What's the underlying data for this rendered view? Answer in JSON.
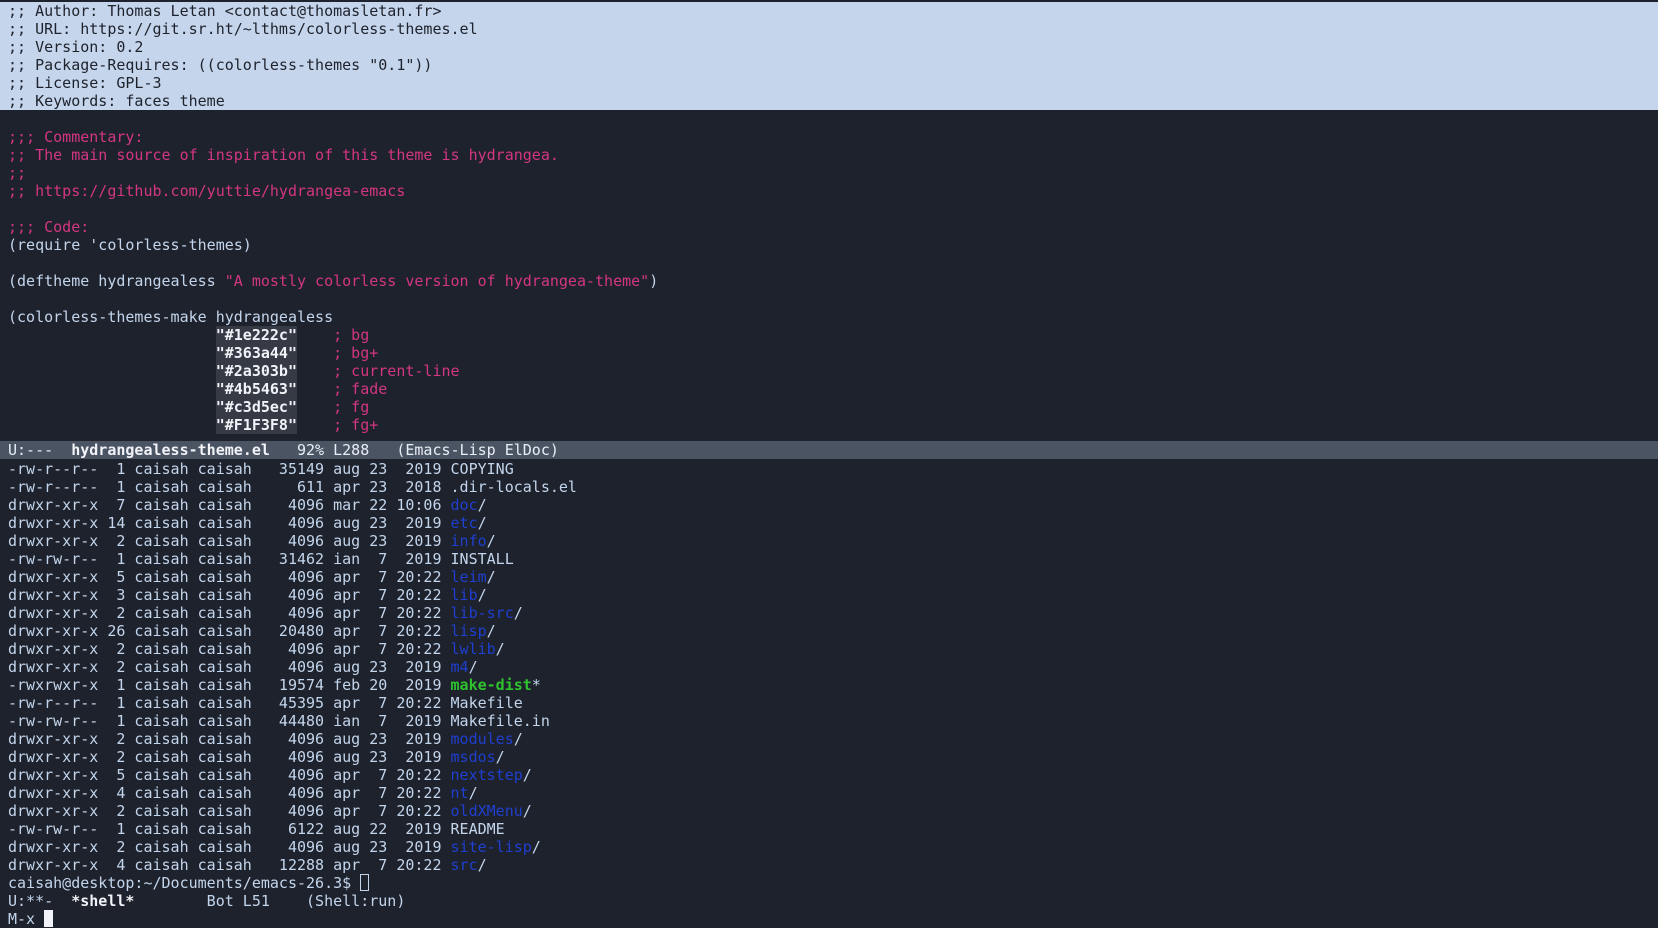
{
  "editor": {
    "header_lines": [
      ";; Author: Thomas Letan <contact@thomasletan.fr>",
      ";; URL: https://git.sr.ht/~lthms/colorless-themes.el",
      ";; Version: 0.2",
      ";; Package-Requires: ((colorless-themes \"0.1\"))",
      ";; License: GPL-3",
      ";; Keywords: faces theme"
    ],
    "commentary_lines": [
      ";;; Commentary:",
      ";; The main source of inspiration of this theme is hydrangea.",
      ";;",
      ";; https://github.com/yuttie/hydrangea-emacs"
    ],
    "code_header": ";;; Code:",
    "require_line": "(require 'colorless-themes)",
    "deftheme_prefix": "(deftheme hydrangealess ",
    "deftheme_string": "\"A mostly colorless version of hydrangea-theme\"",
    "deftheme_suffix": ")",
    "make_line": "(colorless-themes-make hydrangealess",
    "indent": "                       ",
    "colors": [
      {
        "hex": "\"#1e222c\"",
        "gap": "    ",
        "comment": "; bg"
      },
      {
        "hex": "\"#363a44\"",
        "gap": "    ",
        "comment": "; bg+"
      },
      {
        "hex": "\"#2a303b\"",
        "gap": "    ",
        "comment": "; current-line"
      },
      {
        "hex": "\"#4b5463\"",
        "gap": "    ",
        "comment": "; fade"
      },
      {
        "hex": "\"#c3d5ec\"",
        "gap": "    ",
        "comment": "; fg"
      },
      {
        "hex": "\"#F1F3F8\"",
        "gap": "    ",
        "comment": "; fg+"
      }
    ]
  },
  "modeline_top": {
    "status": "U:---  ",
    "buffer": "hydrangealess-theme.el",
    "info": "   92% L288   (Emacs-Lisp ElDoc)"
  },
  "shell": {
    "rows": [
      {
        "perm": "-rw-r--r--  1 caisah caisah   35149 aug 23  2019 ",
        "name": "COPYING",
        "kind": "file",
        "suffix": ""
      },
      {
        "perm": "-rw-r--r--  1 caisah caisah     611 apr 23  2018 ",
        "name": ".dir-locals.el",
        "kind": "file",
        "suffix": ""
      },
      {
        "perm": "drwxr-xr-x  7 caisah caisah    4096 mar 22 10:06 ",
        "name": "doc",
        "kind": "dir",
        "suffix": "/"
      },
      {
        "perm": "drwxr-xr-x 14 caisah caisah    4096 aug 23  2019 ",
        "name": "etc",
        "kind": "dir",
        "suffix": "/"
      },
      {
        "perm": "drwxr-xr-x  2 caisah caisah    4096 aug 23  2019 ",
        "name": "info",
        "kind": "dir",
        "suffix": "/"
      },
      {
        "perm": "-rw-rw-r--  1 caisah caisah   31462 ian  7  2019 ",
        "name": "INSTALL",
        "kind": "file",
        "suffix": ""
      },
      {
        "perm": "drwxr-xr-x  5 caisah caisah    4096 apr  7 20:22 ",
        "name": "leim",
        "kind": "dir",
        "suffix": "/"
      },
      {
        "perm": "drwxr-xr-x  3 caisah caisah    4096 apr  7 20:22 ",
        "name": "lib",
        "kind": "dir",
        "suffix": "/"
      },
      {
        "perm": "drwxr-xr-x  2 caisah caisah    4096 apr  7 20:22 ",
        "name": "lib-src",
        "kind": "dir",
        "suffix": "/"
      },
      {
        "perm": "drwxr-xr-x 26 caisah caisah   20480 apr  7 20:22 ",
        "name": "lisp",
        "kind": "dir",
        "suffix": "/"
      },
      {
        "perm": "drwxr-xr-x  2 caisah caisah    4096 apr  7 20:22 ",
        "name": "lwlib",
        "kind": "dir",
        "suffix": "/"
      },
      {
        "perm": "drwxr-xr-x  2 caisah caisah    4096 aug 23  2019 ",
        "name": "m4",
        "kind": "dir",
        "suffix": "/"
      },
      {
        "perm": "-rwxrwxr-x  1 caisah caisah   19574 feb 20  2019 ",
        "name": "make-dist",
        "kind": "exe",
        "suffix": "*"
      },
      {
        "perm": "-rw-r--r--  1 caisah caisah   45395 apr  7 20:22 ",
        "name": "Makefile",
        "kind": "file",
        "suffix": ""
      },
      {
        "perm": "-rw-rw-r--  1 caisah caisah   44480 ian  7  2019 ",
        "name": "Makefile.in",
        "kind": "file",
        "suffix": ""
      },
      {
        "perm": "drwxr-xr-x  2 caisah caisah    4096 aug 23  2019 ",
        "name": "modules",
        "kind": "dir",
        "suffix": "/"
      },
      {
        "perm": "drwxr-xr-x  2 caisah caisah    4096 aug 23  2019 ",
        "name": "msdos",
        "kind": "dir",
        "suffix": "/"
      },
      {
        "perm": "drwxr-xr-x  5 caisah caisah    4096 apr  7 20:22 ",
        "name": "nextstep",
        "kind": "dir",
        "suffix": "/"
      },
      {
        "perm": "drwxr-xr-x  4 caisah caisah    4096 apr  7 20:22 ",
        "name": "nt",
        "kind": "dir",
        "suffix": "/"
      },
      {
        "perm": "drwxr-xr-x  2 caisah caisah    4096 apr  7 20:22 ",
        "name": "oldXMenu",
        "kind": "dir",
        "suffix": "/"
      },
      {
        "perm": "-rw-rw-r--  1 caisah caisah    6122 aug 22  2019 ",
        "name": "README",
        "kind": "file",
        "suffix": ""
      },
      {
        "perm": "drwxr-xr-x  2 caisah caisah    4096 aug 23  2019 ",
        "name": "site-lisp",
        "kind": "dir",
        "suffix": "/"
      },
      {
        "perm": "drwxr-xr-x  4 caisah caisah   12288 apr  7 20:22 ",
        "name": "src",
        "kind": "dir",
        "suffix": "/"
      }
    ],
    "prompt": "caisah@desktop:~/Documents/emacs-26.3$ "
  },
  "modeline_bottom": {
    "status": "U:**-  ",
    "buffer": "*shell*",
    "info": "        Bot L51    (Shell:run)"
  },
  "minibuffer": {
    "prompt": "M-x "
  }
}
